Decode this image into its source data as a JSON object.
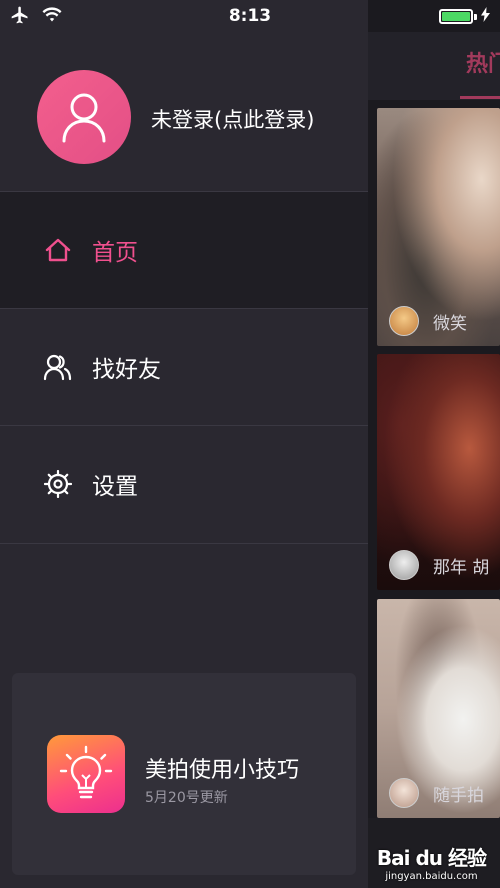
{
  "status_bar": {
    "time": "8:13"
  },
  "profile": {
    "login_text": "未登录(点此登录)"
  },
  "menu": {
    "items": [
      {
        "label": "首页",
        "active": true
      },
      {
        "label": "找好友",
        "active": false
      },
      {
        "label": "设置",
        "active": false
      }
    ]
  },
  "tip_card": {
    "title": "美拍使用小技巧",
    "subtitle": "5月20号更新"
  },
  "content": {
    "tab_hot": "热门",
    "cards": [
      {
        "user": "微笑"
      },
      {
        "user": "那年 胡"
      },
      {
        "user": "随手拍"
      }
    ]
  },
  "watermark": {
    "logo": "Bai du 经验",
    "url": "jingyan.baidu.com"
  },
  "colors": {
    "accent": "#f0508e",
    "drawer_bg": "#2a2830",
    "active_bg": "#1f1e24"
  }
}
